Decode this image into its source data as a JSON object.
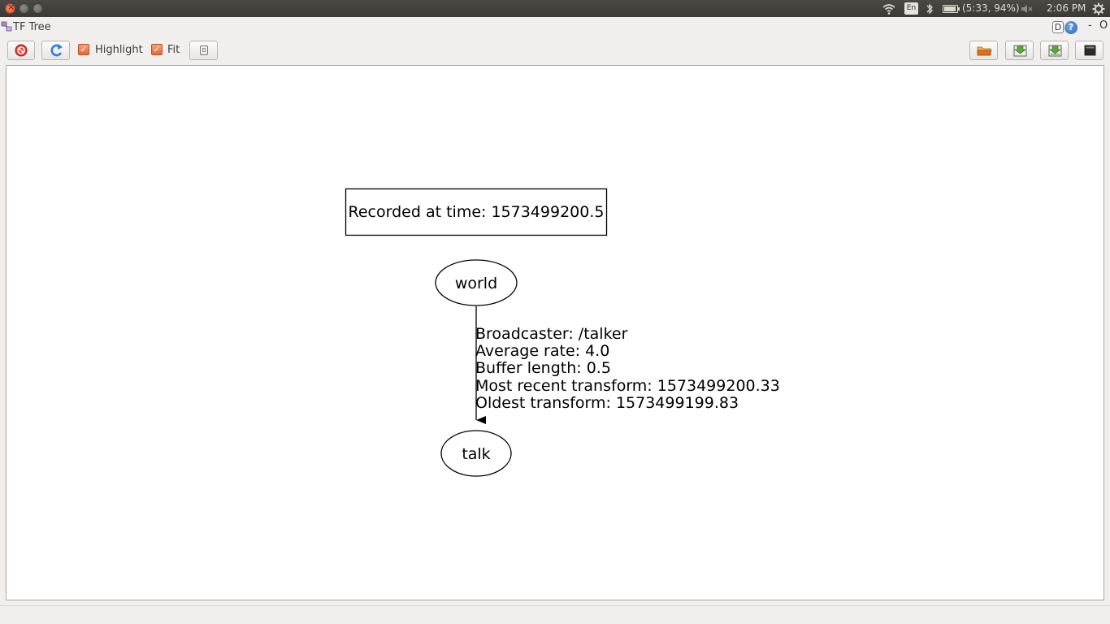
{
  "system_bar": {
    "language": "En",
    "battery_text": "(5:33, 94%)",
    "battery_level": 0.94,
    "clock": "2:06 PM"
  },
  "window": {
    "title": "TF Tree",
    "help_d": "D",
    "help_q": "?",
    "minimize_glyph": "-",
    "close_glyph": "O"
  },
  "toolbar": {
    "highlight_label": "Highlight",
    "highlight_checked": true,
    "fit_label": "Fit",
    "fit_checked": true
  },
  "graph": {
    "recorded_label": "Recorded at time: 1573499200.5",
    "nodes": [
      {
        "id": "world",
        "label": "world"
      },
      {
        "id": "talk",
        "label": "talk"
      }
    ],
    "edge": {
      "from": "world",
      "to": "talk",
      "lines": [
        "Broadcaster: /talker",
        "Average rate: 4.0",
        "Buffer length: 0.5",
        "Most recent transform: 1573499200.33",
        "Oldest transform: 1573499199.83"
      ]
    }
  },
  "icons": {
    "stop": "stop-icon",
    "refresh": "refresh-icon",
    "small": "small-square-icon",
    "open": "folder-open-icon",
    "save_image": "save-image-icon",
    "save_dot": "save-dot-icon",
    "fullscreen": "fullscreen-icon"
  }
}
